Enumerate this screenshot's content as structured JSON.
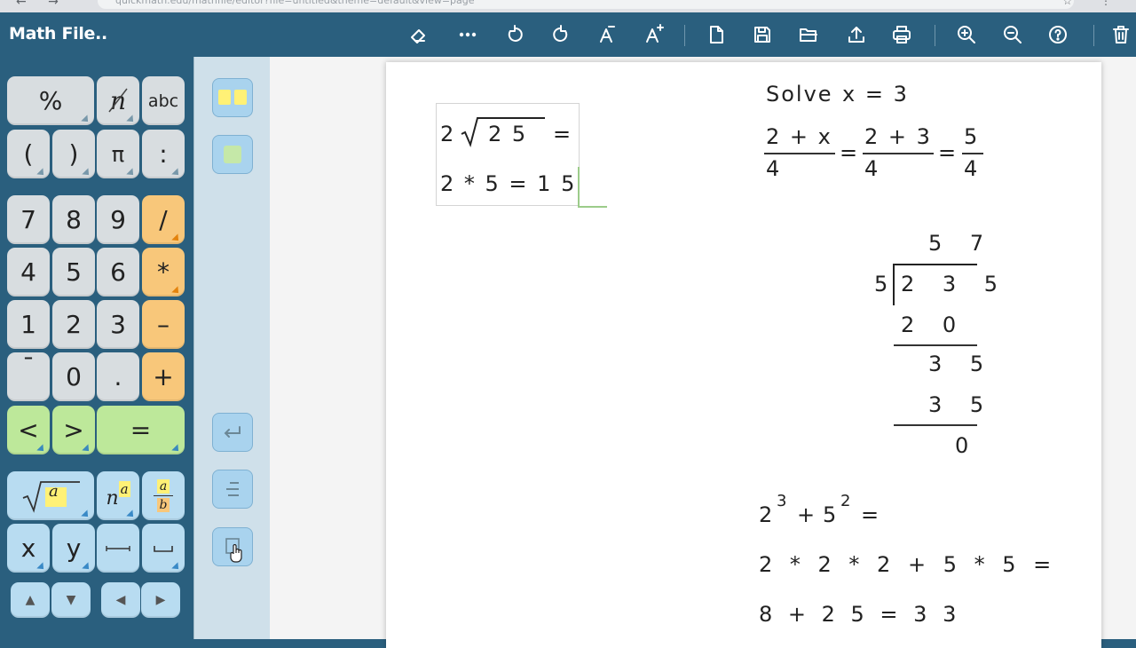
{
  "browser": {
    "nav": "← →",
    "url": "quickmath.edu/mathfile/editor?file=untitled&theme=default&view=page",
    "ext": "☆ ⋮"
  },
  "app": {
    "title": "Math File..",
    "toolbar": [
      {
        "name": "eraser-button",
        "icon": "eraser-icon"
      },
      {
        "name": "more-button",
        "icon": "ellipsis-icon"
      },
      {
        "name": "undo-button",
        "icon": "undo-icon"
      },
      {
        "name": "redo-button",
        "icon": "redo-icon"
      },
      {
        "name": "font-decrease-button",
        "icon": "font-decrease-icon"
      },
      {
        "name": "font-increase-button",
        "icon": "font-increase-icon"
      },
      {
        "name": "new-file-button",
        "icon": "new-file-icon"
      },
      {
        "name": "save-button",
        "icon": "save-icon"
      },
      {
        "name": "open-folder-button",
        "icon": "folder-icon"
      },
      {
        "name": "upload-button",
        "icon": "upload-icon"
      },
      {
        "name": "print-button",
        "icon": "print-icon"
      },
      {
        "name": "zoom-in-button",
        "icon": "zoom-in-icon"
      },
      {
        "name": "zoom-out-button",
        "icon": "zoom-out-icon"
      },
      {
        "name": "help-button",
        "icon": "help-icon"
      },
      {
        "name": "delete-button",
        "icon": "trash-icon"
      }
    ]
  },
  "keypad": {
    "percent": "%",
    "n_strike": "n",
    "abc": "abc",
    "paren_open": "(",
    "paren_close": ")",
    "pi": "π",
    "colon": ":",
    "d7": "7",
    "d8": "8",
    "d9": "9",
    "div": "/",
    "d4": "4",
    "d5": "5",
    "d6": "6",
    "mul": "*",
    "d1": "1",
    "d2": "2",
    "d3": "3",
    "minus": "–",
    "neg": "¯",
    "d0": "0",
    "dot": ".",
    "plus": "+",
    "lt": "<",
    "gt": ">",
    "eq": "=",
    "sqrt_arg": "a",
    "pow_base": "n",
    "pow_exp": "a",
    "frac_num": "a",
    "frac_den": "b",
    "var_x": "x",
    "var_y": "y",
    "arrow_up": "▲",
    "arrow_down": "▼",
    "arrow_left": "◀",
    "arrow_right": "▶"
  },
  "side_panel": {
    "buttons": [
      "two-column-layout",
      "single-block",
      "enter",
      "align",
      "box"
    ]
  },
  "worksheet": {
    "box": {
      "line1_coef": "2",
      "line1_radicand": "2 5",
      "line1_eq": "=",
      "line2": "2 * 5 = 1 5"
    },
    "solve": {
      "title": "Solve",
      "given": "x = 3",
      "f1_num": "2 + x",
      "f1_den": "4",
      "eq1": "=",
      "f2_num": "2 + 3",
      "f2_den": "4",
      "eq2": "=",
      "f3_num": "5",
      "f3_den": "4"
    },
    "division": {
      "quotient": "5 7",
      "divisor": "5",
      "dividend": "2 3 5",
      "step1": "2 0",
      "rem1": "3 5",
      "step2": "3 5",
      "remainder": "0"
    },
    "powers": {
      "base1": "2",
      "exp1": "3",
      "plus": "+",
      "base2": "5",
      "exp2": "2",
      "eq": "=",
      "expand": "2 * 2 * 2 + 5 * 5 =",
      "result": "8 + 2 5 = 3 3"
    }
  }
}
